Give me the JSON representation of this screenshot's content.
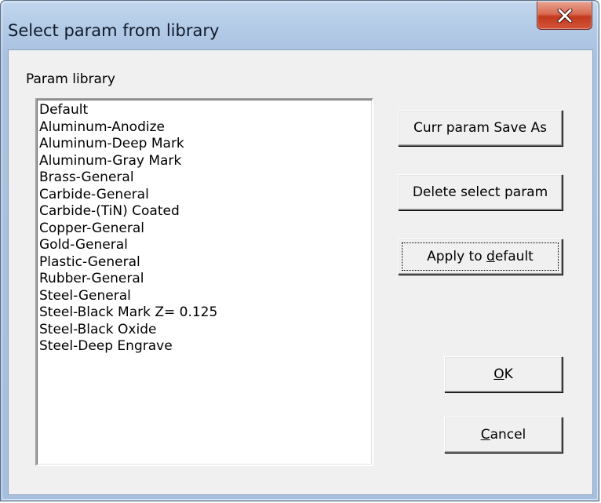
{
  "window": {
    "title": "Select param from library"
  },
  "library": {
    "group_label": "Param library",
    "items": [
      "Default",
      "Aluminum-Anodize",
      "Aluminum-Deep Mark",
      "Aluminum-Gray Mark",
      "Brass-General",
      "Carbide-General",
      "Carbide-(TiN) Coated",
      "Copper-General",
      "Gold-General",
      "Plastic-General",
      "Rubber-General",
      "Steel-General",
      "Steel-Black Mark Z= 0.125",
      "Steel-Black Oxide",
      "Steel-Deep Engrave"
    ]
  },
  "buttons": {
    "save_as": "Curr param Save As",
    "delete": "Delete select param",
    "apply_prefix": "Apply to ",
    "apply_mnemonic": "d",
    "apply_suffix": "efault",
    "ok_mnemonic": "O",
    "ok_suffix": "K",
    "cancel_mnemonic": "C",
    "cancel_suffix": "ancel"
  },
  "icons": {
    "close": "close-icon"
  },
  "colors": {
    "title_bar": "#b5cce7",
    "close_button": "#c2391d",
    "dialog_face": "#f0f0f0"
  }
}
